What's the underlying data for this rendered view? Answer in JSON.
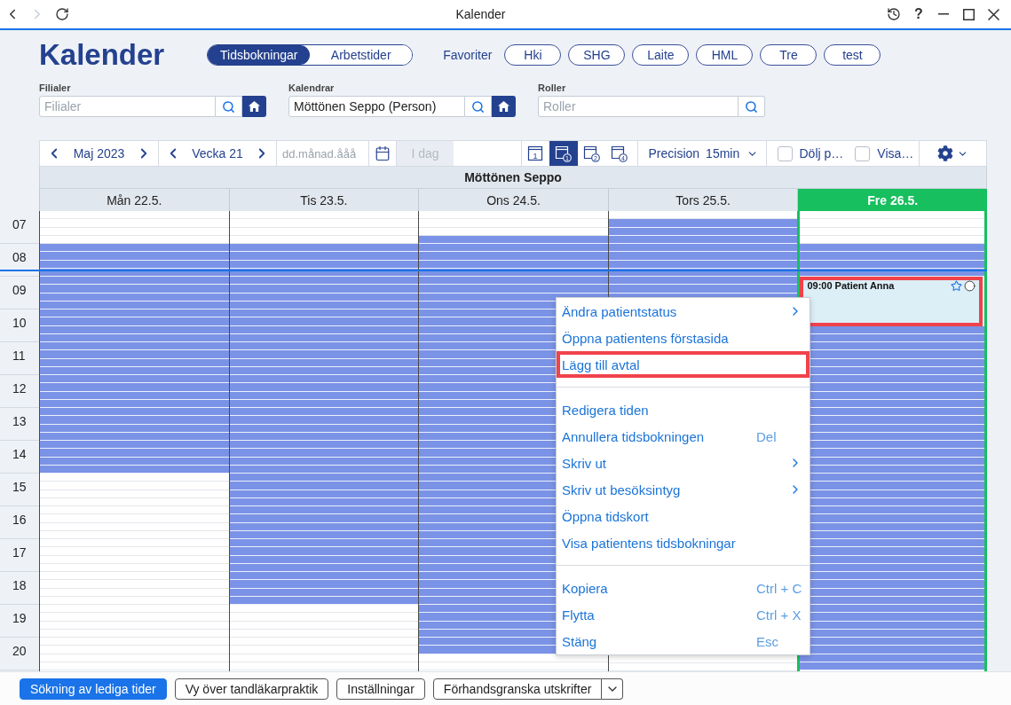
{
  "window": {
    "title": "Kalender",
    "back_disabled": false,
    "forward_disabled": true,
    "help_label": "?"
  },
  "header": {
    "title": "Kalender",
    "view_tabs": [
      {
        "label": "Tidsbokningar",
        "selected": true
      },
      {
        "label": "Arbetstider",
        "selected": false
      }
    ],
    "favorites_label": "Favoriter",
    "favorites": [
      {
        "label": "Hki"
      },
      {
        "label": "SHG"
      },
      {
        "label": "Laite"
      },
      {
        "label": "HML"
      },
      {
        "label": "Tre"
      },
      {
        "label": "test"
      }
    ]
  },
  "filters": [
    {
      "label": "Filialer",
      "placeholder": "Filialer",
      "home_button": true
    },
    {
      "label": "Kalendrar",
      "value": "Möttönen Seppo (Person)",
      "home_button": true
    },
    {
      "label": "Roller",
      "placeholder": "Roller",
      "home_button": false
    }
  ],
  "toolbar": {
    "month": "Maj 2023",
    "week": "Vecka 21",
    "date_placeholder": "dd.månad.ååå",
    "today": {
      "label": "I dag",
      "disabled": true
    },
    "view_modes": [
      {
        "number": "1",
        "kind": "plain",
        "selected": false
      },
      {
        "number": "1",
        "kind": "circled",
        "selected": true
      },
      {
        "number": "2",
        "kind": "circled",
        "selected": false
      },
      {
        "number": "4",
        "kind": "circled",
        "selected": false
      }
    ],
    "precision": {
      "label": "Precision",
      "value": "15min"
    },
    "checkboxes": [
      {
        "label": "Dölj p…",
        "checked": false
      },
      {
        "label": "Visa…",
        "checked": false
      }
    ]
  },
  "calendar": {
    "resource": "Möttönen Seppo",
    "hours": [
      {
        "label": "07",
        "now": false
      },
      {
        "label": "08",
        "now": true
      },
      {
        "label": "09",
        "now": false
      },
      {
        "label": "10",
        "now": false
      },
      {
        "label": "11",
        "now": false
      },
      {
        "label": "12",
        "now": false
      },
      {
        "label": "13",
        "now": false
      },
      {
        "label": "14",
        "now": false
      },
      {
        "label": "15",
        "now": false
      },
      {
        "label": "16",
        "now": false
      },
      {
        "label": "17",
        "now": false
      },
      {
        "label": "18",
        "now": false
      },
      {
        "label": "19",
        "now": false
      },
      {
        "label": "20",
        "now": false
      }
    ],
    "days": [
      {
        "label": "Mån 22.5.",
        "today": false,
        "quarters": [
          {
            "kind": "closed"
          },
          {
            "kind": "closed"
          },
          {
            "kind": "closed"
          },
          {
            "kind": "closed"
          },
          {
            "kind": "free"
          },
          {
            "kind": "free"
          },
          {
            "kind": "free"
          },
          {
            "kind": "free"
          },
          {
            "kind": "free"
          },
          {
            "kind": "free"
          },
          {
            "kind": "free"
          },
          {
            "kind": "free"
          },
          {
            "kind": "free"
          },
          {
            "kind": "free"
          },
          {
            "kind": "free"
          },
          {
            "kind": "free"
          },
          {
            "kind": "free"
          },
          {
            "kind": "free"
          },
          {
            "kind": "free"
          },
          {
            "kind": "free"
          },
          {
            "kind": "free"
          },
          {
            "kind": "free"
          },
          {
            "kind": "free"
          },
          {
            "kind": "free"
          },
          {
            "kind": "free"
          },
          {
            "kind": "free"
          },
          {
            "kind": "free"
          },
          {
            "kind": "free"
          },
          {
            "kind": "free"
          },
          {
            "kind": "free"
          },
          {
            "kind": "free"
          },
          {
            "kind": "free"
          },
          {
            "kind": "closed"
          },
          {
            "kind": "closed"
          },
          {
            "kind": "closed"
          },
          {
            "kind": "closed"
          },
          {
            "kind": "closed"
          },
          {
            "kind": "closed"
          },
          {
            "kind": "closed"
          },
          {
            "kind": "closed"
          },
          {
            "kind": "closed"
          },
          {
            "kind": "closed"
          },
          {
            "kind": "closed"
          },
          {
            "kind": "closed"
          },
          {
            "kind": "closed"
          },
          {
            "kind": "closed"
          },
          {
            "kind": "closed"
          },
          {
            "kind": "closed"
          },
          {
            "kind": "closed"
          },
          {
            "kind": "closed"
          },
          {
            "kind": "closed"
          },
          {
            "kind": "closed"
          },
          {
            "kind": "closed"
          },
          {
            "kind": "closed"
          },
          {
            "kind": "closed"
          },
          {
            "kind": "closed"
          }
        ]
      },
      {
        "label": "Tis 23.5.",
        "today": false,
        "quarters": [
          {
            "kind": "closed"
          },
          {
            "kind": "closed"
          },
          {
            "kind": "closed"
          },
          {
            "kind": "closed"
          },
          {
            "kind": "free"
          },
          {
            "kind": "free"
          },
          {
            "kind": "free"
          },
          {
            "kind": "free"
          },
          {
            "kind": "free"
          },
          {
            "kind": "free"
          },
          {
            "kind": "free"
          },
          {
            "kind": "free"
          },
          {
            "kind": "free"
          },
          {
            "kind": "free"
          },
          {
            "kind": "free"
          },
          {
            "kind": "free"
          },
          {
            "kind": "free"
          },
          {
            "kind": "free"
          },
          {
            "kind": "free"
          },
          {
            "kind": "free"
          },
          {
            "kind": "free"
          },
          {
            "kind": "free"
          },
          {
            "kind": "free"
          },
          {
            "kind": "free"
          },
          {
            "kind": "free"
          },
          {
            "kind": "free"
          },
          {
            "kind": "free"
          },
          {
            "kind": "free"
          },
          {
            "kind": "free"
          },
          {
            "kind": "free"
          },
          {
            "kind": "free"
          },
          {
            "kind": "free"
          },
          {
            "kind": "free"
          },
          {
            "kind": "free"
          },
          {
            "kind": "free"
          },
          {
            "kind": "free"
          },
          {
            "kind": "free"
          },
          {
            "kind": "free"
          },
          {
            "kind": "free"
          },
          {
            "kind": "free"
          },
          {
            "kind": "free"
          },
          {
            "kind": "free"
          },
          {
            "kind": "free"
          },
          {
            "kind": "free"
          },
          {
            "kind": "free"
          },
          {
            "kind": "free"
          },
          {
            "kind": "free"
          },
          {
            "kind": "free"
          },
          {
            "kind": "closed"
          },
          {
            "kind": "closed"
          },
          {
            "kind": "closed"
          },
          {
            "kind": "closed"
          },
          {
            "kind": "closed"
          },
          {
            "kind": "closed"
          },
          {
            "kind": "closed"
          },
          {
            "kind": "closed"
          }
        ]
      },
      {
        "label": "Ons 24.5.",
        "today": false,
        "quarters": [
          {
            "kind": "closed"
          },
          {
            "kind": "closed"
          },
          {
            "kind": "closed"
          },
          {
            "kind": "free"
          },
          {
            "kind": "free"
          },
          {
            "kind": "free"
          },
          {
            "kind": "free"
          },
          {
            "kind": "free"
          },
          {
            "kind": "free"
          },
          {
            "kind": "free"
          },
          {
            "kind": "free"
          },
          {
            "kind": "free"
          },
          {
            "kind": "free"
          },
          {
            "kind": "free"
          },
          {
            "kind": "free"
          },
          {
            "kind": "free"
          },
          {
            "kind": "free"
          },
          {
            "kind": "free"
          },
          {
            "kind": "free"
          },
          {
            "kind": "free"
          },
          {
            "kind": "free"
          },
          {
            "kind": "free"
          },
          {
            "kind": "free"
          },
          {
            "kind": "free"
          },
          {
            "kind": "free"
          },
          {
            "kind": "free"
          },
          {
            "kind": "free"
          },
          {
            "kind": "free"
          },
          {
            "kind": "free"
          },
          {
            "kind": "free"
          },
          {
            "kind": "free"
          },
          {
            "kind": "free"
          },
          {
            "kind": "free"
          },
          {
            "kind": "free"
          },
          {
            "kind": "free"
          },
          {
            "kind": "free"
          },
          {
            "kind": "free"
          },
          {
            "kind": "free"
          },
          {
            "kind": "free"
          },
          {
            "kind": "free"
          },
          {
            "kind": "free"
          },
          {
            "kind": "free"
          },
          {
            "kind": "free"
          },
          {
            "kind": "free"
          },
          {
            "kind": "free"
          },
          {
            "kind": "free"
          },
          {
            "kind": "free"
          },
          {
            "kind": "free"
          },
          {
            "kind": "free"
          },
          {
            "kind": "free"
          },
          {
            "kind": "free"
          },
          {
            "kind": "free"
          },
          {
            "kind": "free"
          },
          {
            "kind": "free"
          },
          {
            "kind": "closed"
          },
          {
            "kind": "closed"
          }
        ]
      },
      {
        "label": "Tors 25.5.",
        "today": false,
        "quarters": [
          {
            "kind": "closed"
          },
          {
            "kind": "free"
          },
          {
            "kind": "free"
          },
          {
            "kind": "free"
          },
          {
            "kind": "free"
          },
          {
            "kind": "free"
          },
          {
            "kind": "free"
          },
          {
            "kind": "free"
          },
          {
            "kind": "free"
          },
          {
            "kind": "free"
          },
          {
            "kind": "free"
          }
        ],
        "last_quarters": [
          {
            "kind": "closed"
          },
          {
            "kind": "closed"
          }
        ]
      },
      {
        "label": "Fre 26.5.",
        "today": true,
        "quarters": [
          {
            "kind": "closed"
          },
          {
            "kind": "closed"
          },
          {
            "kind": "closed"
          },
          {
            "kind": "closed"
          },
          {
            "kind": "free"
          },
          {
            "kind": "free"
          },
          {
            "kind": "free"
          },
          {
            "kind": "free"
          },
          {
            "kind": "booked"
          },
          {
            "kind": "booked"
          },
          {
            "kind": "booked"
          },
          {
            "kind": "booked"
          },
          {
            "kind": "booked"
          },
          {
            "kind": "booked"
          },
          {
            "kind": "free"
          },
          {
            "kind": "free"
          },
          {
            "kind": "free"
          },
          {
            "kind": "free"
          },
          {
            "kind": "free"
          },
          {
            "kind": "free"
          },
          {
            "kind": "free"
          },
          {
            "kind": "free"
          },
          {
            "kind": "free"
          },
          {
            "kind": "free"
          },
          {
            "kind": "free"
          },
          {
            "kind": "free"
          },
          {
            "kind": "free"
          },
          {
            "kind": "free"
          },
          {
            "kind": "free"
          },
          {
            "kind": "free"
          },
          {
            "kind": "free"
          },
          {
            "kind": "free"
          },
          {
            "kind": "free"
          },
          {
            "kind": "free"
          },
          {
            "kind": "free"
          },
          {
            "kind": "free"
          },
          {
            "kind": "free"
          },
          {
            "kind": "free"
          },
          {
            "kind": "free"
          },
          {
            "kind": "free"
          },
          {
            "kind": "free"
          },
          {
            "kind": "free"
          },
          {
            "kind": "free"
          },
          {
            "kind": "free"
          },
          {
            "kind": "free"
          },
          {
            "kind": "free"
          },
          {
            "kind": "free"
          },
          {
            "kind": "free"
          },
          {
            "kind": "free"
          },
          {
            "kind": "free"
          },
          {
            "kind": "free"
          },
          {
            "kind": "free"
          },
          {
            "kind": "free"
          },
          {
            "kind": "free"
          },
          {
            "kind": "free"
          },
          {
            "kind": "free"
          }
        ],
        "events": [
          {
            "label": "09:00 Patient Anna",
            "starred": false,
            "highlighted": true
          }
        ]
      }
    ]
  },
  "context_menu": {
    "items": [
      {
        "kind": "item",
        "label": "Ändra patientstatus",
        "submenu": true,
        "highlighted": false
      },
      {
        "kind": "item",
        "label": "Öppna patientens förstasida",
        "submenu": false,
        "highlighted": false
      },
      {
        "kind": "item",
        "label": "Lägg till avtal",
        "submenu": false,
        "highlighted": true
      },
      {
        "kind": "separator"
      },
      {
        "kind": "item",
        "label": "Redigera tiden",
        "submenu": false,
        "highlighted": false
      },
      {
        "kind": "item",
        "label": "Annullera tidsbokningen",
        "shortcut": "Del",
        "submenu": false,
        "highlighted": false
      },
      {
        "kind": "item",
        "label": "Skriv ut",
        "submenu": true,
        "highlighted": false
      },
      {
        "kind": "item",
        "label": "Skriv ut besöksintyg",
        "submenu": true,
        "highlighted": false
      },
      {
        "kind": "item",
        "label": "Öppna tidskort",
        "submenu": false,
        "highlighted": false
      },
      {
        "kind": "item",
        "label": "Visa patientens tidsbokningar",
        "submenu": false,
        "highlighted": false
      },
      {
        "kind": "separator"
      },
      {
        "kind": "item",
        "label": "Kopiera",
        "shortcut": "Ctrl + C",
        "submenu": false,
        "highlighted": false
      },
      {
        "kind": "item",
        "label": "Flytta",
        "shortcut": "Ctrl + X",
        "submenu": false,
        "highlighted": false
      },
      {
        "kind": "item",
        "label": "Stäng",
        "shortcut": "Esc",
        "submenu": false,
        "highlighted": false
      }
    ]
  },
  "footer": {
    "buttons": [
      {
        "label": "Sökning av lediga tider",
        "primary": true,
        "dropdown": false
      },
      {
        "label": "Vy över tandläkarpraktik",
        "primary": false,
        "dropdown": false
      },
      {
        "label": "Inställningar",
        "primary": false,
        "dropdown": false
      },
      {
        "label": "Förhandsgranska utskrifter",
        "primary": false,
        "dropdown": true
      }
    ]
  }
}
